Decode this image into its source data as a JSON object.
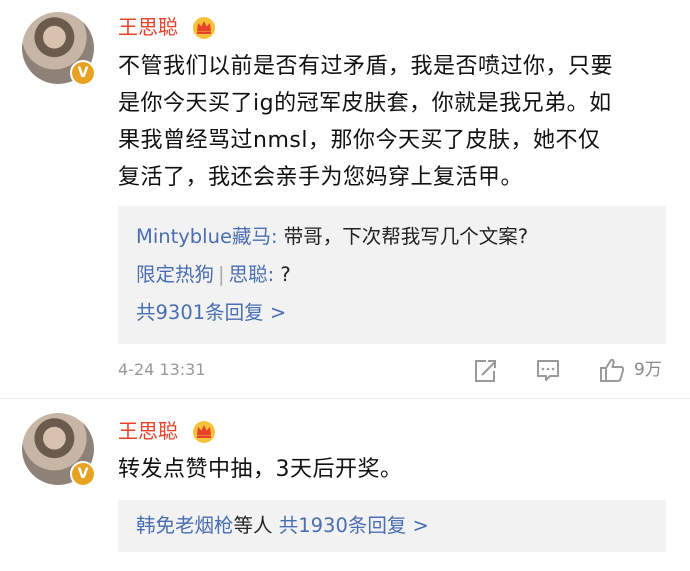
{
  "comments": [
    {
      "author": "王思聪",
      "verified_badge": "V",
      "crown_icon": "crown-vip-icon",
      "text_lines": [
        "不管我们以前是否有过矛盾，我是否喷过你，只要",
        "是你今天买了ig的冠军皮肤套，你就是我兄弟。如",
        "果我曾经骂过nmsl，那你今天买了皮肤，她不仅",
        "复活了，我还会亲手为您妈穿上复活甲。"
      ],
      "replies": [
        {
          "user": "Mintyblue藏马",
          "colon": ":",
          "text": " 带哥，下次帮我写几个文案?"
        },
        {
          "user": "限定热狗",
          "sep": "|",
          "user2": "思聪",
          "colon": ":",
          "text": " ?"
        }
      ],
      "reply_count_label": "共9301条回复 >",
      "timestamp": "4-24 13:31",
      "likes": "9万"
    },
    {
      "author": "王思聪",
      "verified_badge": "V",
      "crown_icon": "crown-vip-icon",
      "text_lines": [
        "转发点赞中抽，3天后开奖。"
      ],
      "reply_summary_users": "韩免老烟枪",
      "reply_summary_mid": "等人",
      "reply_summary_count": " 共1930条回复 >"
    }
  ],
  "colors": {
    "name": "#e8412a",
    "link": "#4a6fb0",
    "verified": "#e8a221",
    "reply_bg": "#f2f2f2"
  }
}
